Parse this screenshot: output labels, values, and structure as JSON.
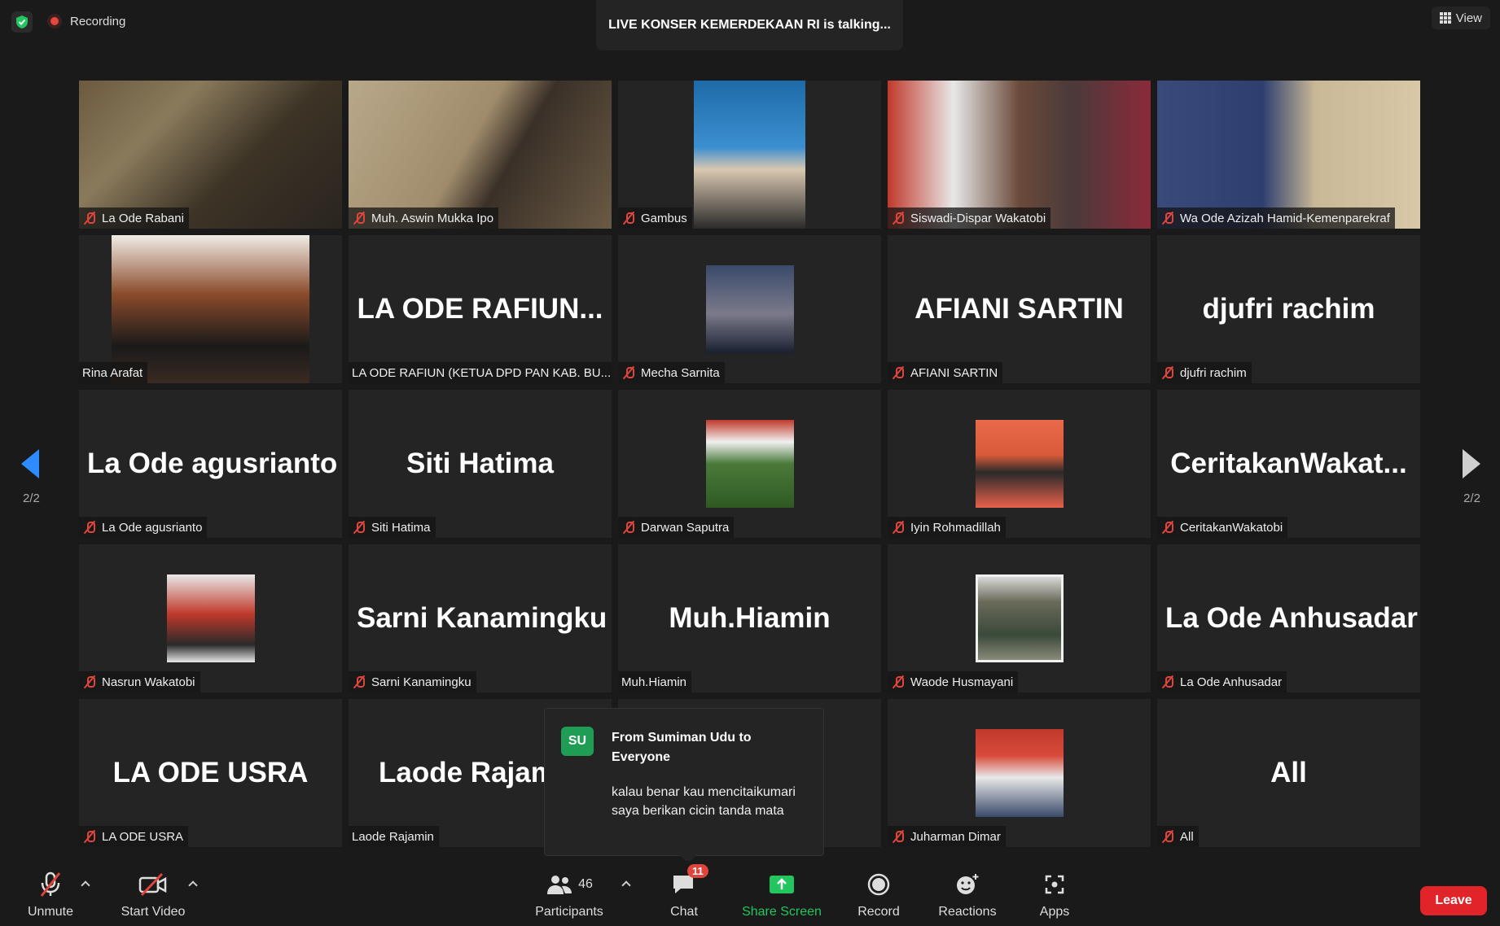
{
  "topbar": {
    "recording_label": "Recording",
    "talking_banner": "LIVE KONSER KEMERDEKAAN RI is talking...",
    "view_label": "View"
  },
  "pagination": {
    "left": "2/2",
    "right": "2/2"
  },
  "tiles": [
    {
      "name": "La Ode Rabani",
      "label": "La Ode Rabani",
      "muted": true
    },
    {
      "name": "Muh. Aswin Mukka Ipo",
      "label": "Muh. Aswin Mukka Ipo",
      "muted": true
    },
    {
      "name": "Gambus",
      "label": "Gambus",
      "muted": true
    },
    {
      "name": "Siswadi-Dispar Wakatobi",
      "label": "Siswadi-Dispar Wakatobi",
      "muted": true
    },
    {
      "name": "Wa Ode Azizah Hamid-Kemenparekraf",
      "label": "Wa Ode Azizah Hamid-Kemenparekraf",
      "muted": true
    },
    {
      "name": "Rina Arafat",
      "label": "Rina Arafat",
      "muted": false
    },
    {
      "name": "LA ODE RAFIUN...",
      "label": "LA ODE RAFIUN (KETUA DPD PAN KAB. BU...",
      "muted": false
    },
    {
      "name": "Mecha Sarnita",
      "label": "Mecha Sarnita",
      "muted": true
    },
    {
      "name": "AFIANI SARTIN",
      "label": "AFIANI SARTIN",
      "muted": true
    },
    {
      "name": "djufri rachim",
      "label": "djufri rachim",
      "muted": true
    },
    {
      "name": "La Ode agusrianto",
      "label": "La Ode agusrianto",
      "muted": true
    },
    {
      "name": "Siti Hatima",
      "label": "Siti Hatima",
      "muted": true
    },
    {
      "name": "Darwan Saputra",
      "label": "Darwan Saputra",
      "muted": true
    },
    {
      "name": "Iyin Rohmadillah",
      "label": "Iyin Rohmadillah",
      "muted": true
    },
    {
      "name": "CeritakanWakat...",
      "label": "CeritakanWakatobi",
      "muted": true
    },
    {
      "name": "Nasrun Wakatobi",
      "label": "Nasrun Wakatobi",
      "muted": true
    },
    {
      "name": "Sarni Kanamingku",
      "label": "Sarni Kanamingku",
      "muted": true
    },
    {
      "name": "Muh.Hiamin",
      "label": "Muh.Hiamin",
      "muted": false
    },
    {
      "name": "Waode Husmayani",
      "label": "Waode Husmayani",
      "muted": true
    },
    {
      "name": "La Ode Anhusadar",
      "label": "La Ode Anhusadar",
      "muted": true
    },
    {
      "name": "LA ODE USRA",
      "label": "LA ODE USRA",
      "muted": true
    },
    {
      "name": "Laode Rajamin",
      "label": "Laode Rajamin",
      "muted": false
    },
    {
      "name": "",
      "label": "",
      "muted": false
    },
    {
      "name": "Juharman Dimar",
      "label": "Juharman Dimar",
      "muted": true
    },
    {
      "name": "All",
      "label": "All",
      "muted": true
    }
  ],
  "chat_popup": {
    "avatar": "SU",
    "from": "From Sumiman Udu to Everyone",
    "message": "kalau benar kau mencitaikumari saya berikan cicin tanda mata"
  },
  "toolbar": {
    "unmute": "Unmute",
    "start_video": "Start Video",
    "participants": "Participants",
    "participants_count": "46",
    "chat": "Chat",
    "chat_badge": "11",
    "share_screen": "Share Screen",
    "record": "Record",
    "reactions": "Reactions",
    "apps": "Apps",
    "leave": "Leave"
  },
  "colors": {
    "background": "#1a1a1a",
    "tile": "#242424",
    "accent_blue": "#2d8cff",
    "share_green": "#22c55e",
    "leave_red": "#e0242a",
    "muted_red": "#e0453c"
  }
}
